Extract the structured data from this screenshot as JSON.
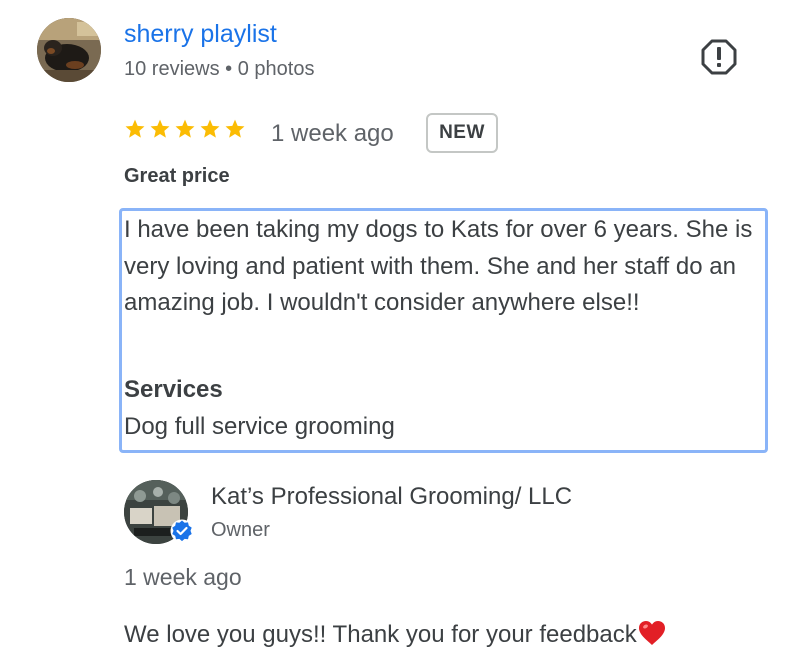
{
  "reviewer": {
    "name": "sherry playlist",
    "meta": "10 reviews • 0 photos",
    "avatar_icon": "dog-photo-avatar"
  },
  "report_icon": "report-flag-icon",
  "review": {
    "rating": 5,
    "rating_max": 5,
    "date": "1 week ago",
    "badge": "NEW",
    "title": "Great price",
    "text": "I have been taking my dogs to Kats for over 6 years. She is very loving and patient with them. She and her staff do an amazing job. I wouldn't consider anywhere else!!",
    "services_label": "Services",
    "services_value": "Dog full service grooming"
  },
  "owner_reply": {
    "name": "Kat’s Professional Grooming/ LLC",
    "role": "Owner",
    "date": "1 week ago",
    "text": "We love you guys!! Thank you for your feedback",
    "emoji": "heart-emoji",
    "verified_icon": "verified-check-icon"
  },
  "colors": {
    "name_link": "#1a73e8",
    "star": "#fbbc04",
    "focus_border": "#8ab4f8",
    "verified": "#1a73e8",
    "heart": "#e21f26"
  }
}
